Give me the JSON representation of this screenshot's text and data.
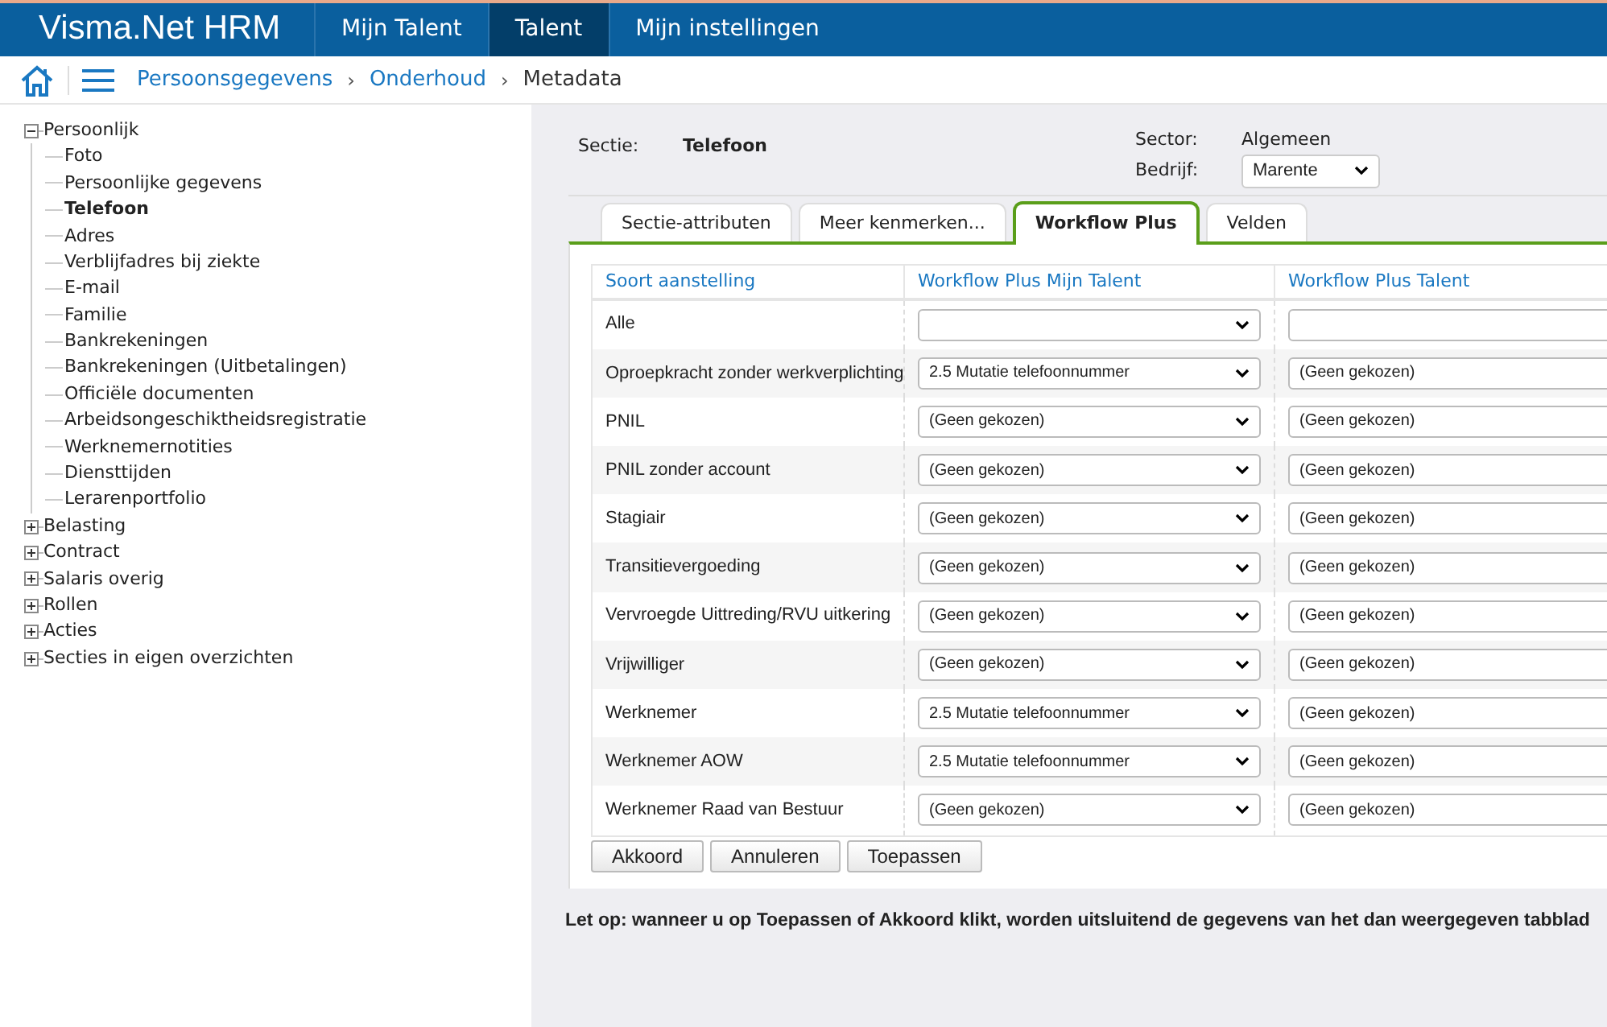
{
  "header": {
    "brand": "Visma.Net HRM",
    "nav": [
      {
        "label": "Mijn Talent",
        "selected": false
      },
      {
        "label": "Talent",
        "selected": true
      },
      {
        "label": "Mijn instellingen",
        "selected": false
      }
    ]
  },
  "breadcrumb": [
    {
      "label": "Persoonsgegevens",
      "link": true
    },
    {
      "separator": "›",
      "label": "Onderhoud",
      "link": true
    },
    {
      "separator": "›",
      "label": "Metadata",
      "link": false
    }
  ],
  "tree": [
    {
      "label": "Persoonlijk",
      "expanded": true,
      "children": [
        {
          "label": "Foto",
          "selected": false
        },
        {
          "label": "Persoonlijke gegevens",
          "selected": false
        },
        {
          "label": "Telefoon",
          "selected": true
        },
        {
          "label": "Adres",
          "selected": false
        },
        {
          "label": "Verblijfadres bij ziekte",
          "selected": false
        },
        {
          "label": "E-mail",
          "selected": false
        },
        {
          "label": "Familie",
          "selected": false
        },
        {
          "label": "Bankrekeningen",
          "selected": false
        },
        {
          "label": "Bankrekeningen (Uitbetalingen)",
          "selected": false
        },
        {
          "label": "Officiële documenten",
          "selected": false
        },
        {
          "label": "Arbeidsongeschiktheidsregistratie",
          "selected": false
        },
        {
          "label": "Werknemernotities",
          "selected": false
        },
        {
          "label": "Diensttijden",
          "selected": false
        },
        {
          "label": "Lerarenportfolio",
          "selected": false
        }
      ]
    },
    {
      "label": "Belasting",
      "expanded": false
    },
    {
      "label": "Contract",
      "expanded": false
    },
    {
      "label": "Salaris overig",
      "expanded": false
    },
    {
      "label": "Rollen",
      "expanded": false
    },
    {
      "label": "Acties",
      "expanded": false
    },
    {
      "label": "Secties in eigen overzichten",
      "expanded": false
    }
  ],
  "section": {
    "label": "Sectie:",
    "value": "Telefoon"
  },
  "sector": {
    "label": "Sector:",
    "value": "Algemeen"
  },
  "company": {
    "label": "Bedrijf:",
    "value": "Marente"
  },
  "tabs": [
    {
      "label": "Sectie-attributen",
      "selected": false
    },
    {
      "label": "Meer kenmerken...",
      "selected": false
    },
    {
      "label": "Workflow Plus",
      "selected": true
    },
    {
      "label": "Velden",
      "selected": false
    }
  ],
  "table": {
    "columns": [
      "Soort aanstelling",
      "Workflow Plus Mijn Talent",
      "Workflow Plus Talent"
    ],
    "rows": [
      {
        "type": "Alle",
        "mijn_talent": null,
        "talent": null
      },
      {
        "type": "Oproepkracht zonder werkverplichting",
        "mijn_talent": "2.5 Mutatie telefoonnummer",
        "talent": "(Geen gekozen)"
      },
      {
        "type": "PNIL",
        "mijn_talent": "(Geen gekozen)",
        "talent": "(Geen gekozen)"
      },
      {
        "type": "PNIL zonder account",
        "mijn_talent": "(Geen gekozen)",
        "talent": "(Geen gekozen)"
      },
      {
        "type": "Stagiair",
        "mijn_talent": "(Geen gekozen)",
        "talent": "(Geen gekozen)"
      },
      {
        "type": "Transitievergoeding",
        "mijn_talent": "(Geen gekozen)",
        "talent": "(Geen gekozen)"
      },
      {
        "type": "Vervroegde Uittreding/RVU uitkering",
        "mijn_talent": "(Geen gekozen)",
        "talent": "(Geen gekozen)"
      },
      {
        "type": "Vrijwilliger",
        "mijn_talent": "(Geen gekozen)",
        "talent": "(Geen gekozen)"
      },
      {
        "type": "Werknemer",
        "mijn_talent": "2.5 Mutatie telefoonnummer",
        "talent": "(Geen gekozen)"
      },
      {
        "type": "Werknemer AOW",
        "mijn_talent": "2.5 Mutatie telefoonnummer",
        "talent": "(Geen gekozen)"
      },
      {
        "type": "Werknemer Raad van Bestuur",
        "mijn_talent": "(Geen gekozen)",
        "talent": "(Geen gekozen)"
      }
    ]
  },
  "buttons": [
    "Akkoord",
    "Annuleren",
    "Toepassen"
  ],
  "note": "Let op: wanneer u op Toepassen of Akkoord klikt, worden uitsluitend de gegevens van het dan weergegeven tabblad"
}
